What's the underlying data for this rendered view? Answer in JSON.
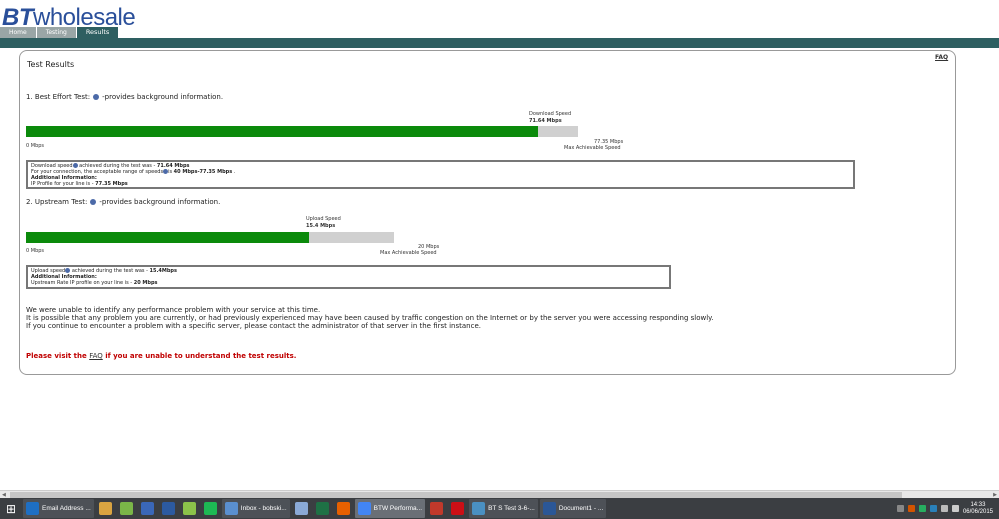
{
  "header": {
    "logo_bt": "BT",
    "logo_wholesale": "wholesale"
  },
  "tabs": [
    {
      "label": "Home"
    },
    {
      "label": "Testing"
    },
    {
      "label": "Results"
    }
  ],
  "faq_top": "FAQ",
  "title": "Test Results",
  "download": {
    "heading_prefix": "1. Best Effort Test:",
    "heading_suffix": "-provides background information.",
    "speed_label": "Download Speed",
    "speed_value": "71.64 Mbps",
    "fill_fraction": 0.928,
    "zero": "0 Mbps",
    "max_value": "77.35 Mbps",
    "max_label": "Max Achievable Speed",
    "box": {
      "l1a": "Download speed",
      "l1b": "achieved during the test was -",
      "l1c": "71.64 Mbps",
      "l2a": "For your connection, the acceptable range of speeds",
      "l2b": "is",
      "l2c": "40 Mbps-77.35 Mbps",
      "l2d": ".",
      "l3": "Additional Information:",
      "l4a": "IP Profile for your line is -",
      "l4b": "77.35 Mbps"
    }
  },
  "upload": {
    "heading_prefix": "2. Upstream Test:",
    "heading_suffix": "-provides background information.",
    "speed_label": "Upload Speed",
    "speed_value": "15.4 Mbps",
    "fill_fraction": 0.77,
    "zero": "0 Mbps",
    "max_value": "20 Mbps",
    "max_label": "Max Achievable Speed",
    "box": {
      "l1a": "Upload speed",
      "l1b": "achieved during the test was -",
      "l1c": "15.4Mbps",
      "l2": "Additional Information:",
      "l3a": "Upstream Rate IP profile on your line is -",
      "l3b": "20 Mbps"
    }
  },
  "notes": {
    "line1": "We were unable to identify any performance problem with your service at this time.",
    "line2": "It is possible that any problem you are currently, or had previously experienced may have been caused by traffic congestion on the Internet or by the server you were accessing responding slowly.",
    "line3": "If you continue to encounter a problem with a specific server, please contact the administrator of that server in the first instance."
  },
  "red_note": {
    "prefix": "Please visit the",
    "link": "FAQ",
    "suffix": "if you are unable to understand the test results."
  },
  "taskbar": {
    "items": [
      {
        "label": "Email Address ...",
        "icon": "ie-icon",
        "color": "#1e6fc4"
      },
      {
        "label": "",
        "icon": "folder-icon",
        "color": "#d9a441"
      },
      {
        "label": "",
        "icon": "leaf-icon",
        "color": "#7ab648"
      },
      {
        "label": "",
        "icon": "network-icon",
        "color": "#3a67b8"
      },
      {
        "label": "",
        "icon": "pc-icon",
        "color": "#2c5aa0"
      },
      {
        "label": "",
        "icon": "android-icon",
        "color": "#8bc34a"
      },
      {
        "label": "",
        "icon": "spotify-icon",
        "color": "#1db954"
      },
      {
        "label": "Inbox - bobski...",
        "icon": "mail-icon",
        "color": "#5a8fcf"
      },
      {
        "label": "",
        "icon": "notepad-icon",
        "color": "#8aa9d6"
      },
      {
        "label": "",
        "icon": "excel-icon",
        "color": "#1e7145"
      },
      {
        "label": "",
        "icon": "firefox-icon",
        "color": "#e66000"
      },
      {
        "label": "BTW Performa...",
        "icon": "chrome-icon",
        "color": "#4285f4"
      },
      {
        "label": "",
        "icon": "grid-icon",
        "color": "#c0392b"
      },
      {
        "label": "",
        "icon": "opera-icon",
        "color": "#cc0f16"
      },
      {
        "label": "BT S Test 3-6-...",
        "icon": "image-icon",
        "color": "#4a90c2"
      },
      {
        "label": "Document1 - ...",
        "icon": "word-icon",
        "color": "#2b5797"
      }
    ],
    "time": "14:33",
    "date": "06/06/2015"
  }
}
